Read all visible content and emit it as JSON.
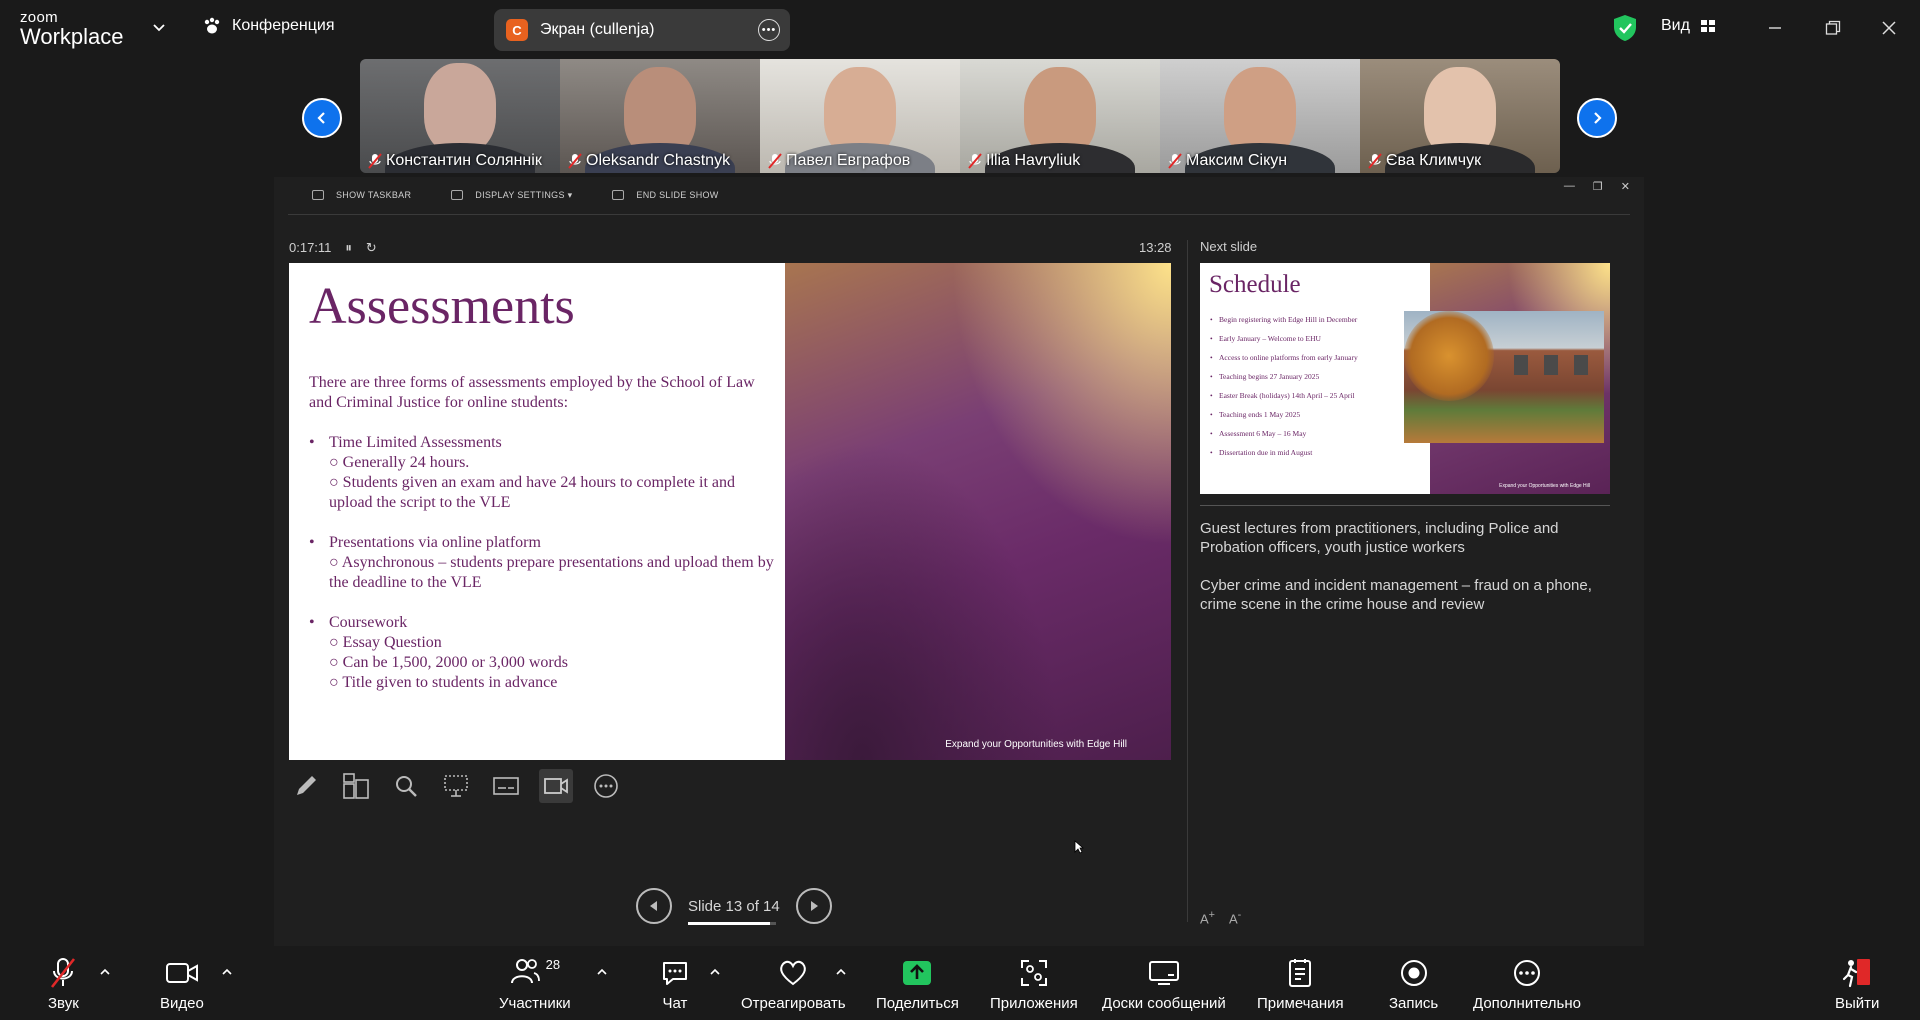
{
  "app": {
    "logo_line1": "zoom",
    "logo_line2": "Workplace",
    "conference_label": "Конференция",
    "screen_badge_letter": "C",
    "screen_share_label": "Экран (cullenja)",
    "view_label": "Вид"
  },
  "participants": [
    {
      "name": "Константин Соляннік"
    },
    {
      "name": "Oleksandr Chastnyk"
    },
    {
      "name": "Павел Евграфов"
    },
    {
      "name": "Illia Havryliuk"
    },
    {
      "name": "Максим Сікун"
    },
    {
      "name": "Єва Климчук"
    }
  ],
  "presenter": {
    "toolbar": {
      "show_taskbar": "SHOW TASKBAR",
      "display_settings": "DISPLAY SETTINGS ▾",
      "end_slide_show": "END SLIDE SHOW"
    },
    "elapsed_time": "0:17:11",
    "clock": "13:28",
    "next_slide_label": "Next slide",
    "slide_counter": "Slide 13 of 14",
    "progress_fraction": 0.93
  },
  "slide": {
    "title": "Assessments",
    "intro": "There are three forms of assessments employed by the School of Law and Criminal Justice for online students:",
    "groups": [
      {
        "bullet": "Time Limited Assessments",
        "subs": [
          "○ Generally 24 hours.",
          "○ Students given an exam and have 24 hours to complete it and upload the script to the VLE"
        ]
      },
      {
        "bullet": "Presentations via online platform",
        "subs": [
          "○ Asynchronous – students prepare presentations and upload them by the deadline to the VLE"
        ]
      },
      {
        "bullet": "Coursework",
        "subs": [
          "○ Essay Question",
          "○ Can be 1,500, 2000 or 3,000 words",
          "○ Title given to students in advance"
        ]
      }
    ],
    "footer": "Expand your Opportunities with Edge Hill"
  },
  "next_slide": {
    "title": "Schedule",
    "items": [
      "Begin registering with Edge Hill in December",
      "Early January – Welcome to EHU",
      "Access to online platforms from early January",
      "Teaching begins 27 January 2025",
      "Easter Break (holidays) 14th April – 25 April",
      "Teaching ends 1 May 2025",
      "Assessment 6 May – 16 May",
      "Dissertation due in mid August"
    ],
    "footer": "Expand your Opportunities with Edge Hill"
  },
  "notes": [
    "Guest lectures from practitioners, including Police and Probation officers, youth justice workers",
    "Cyber crime and incident management – fraud on a phone, crime scene in the crime house and review"
  ],
  "toolbar": {
    "audio": "Звук",
    "video": "Видео",
    "participants": "Участники",
    "participants_count": "28",
    "chat": "Чат",
    "react": "Отреагировать",
    "share": "Поделиться",
    "apps": "Приложения",
    "whiteboards": "Доски сообщений",
    "notes": "Примечания",
    "record": "Запись",
    "more": "Дополнительно",
    "leave": "Выйти"
  },
  "colors": {
    "accent_blue": "#0e72ed",
    "share_green": "#22c55e",
    "slide_purple": "#6a2565",
    "shield_green": "#22c55e",
    "mute_red": "#e02828"
  }
}
